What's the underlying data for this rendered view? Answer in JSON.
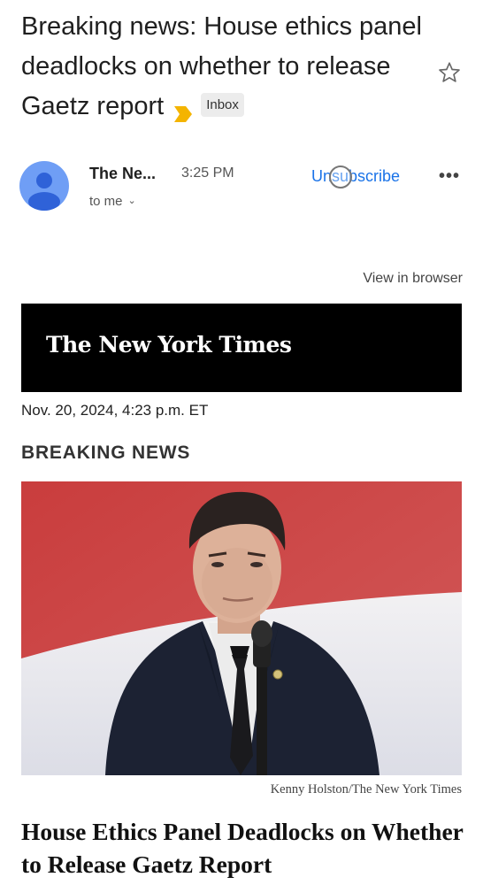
{
  "email": {
    "subject": "Breaking news: House ethics panel deadlocks on whether to release Gaetz report",
    "label": "Inbox",
    "icons": {
      "importance": "importance-marker-icon",
      "star": "star-icon",
      "avatar": "person-avatar-icon",
      "more": "more-horizontal-icon"
    },
    "colors": {
      "importance": "#f4b400",
      "avatar": "#6f9ef5",
      "link": "#1a73e8"
    }
  },
  "sender": {
    "name": "The Ne...",
    "time": "3:25 PM",
    "recipient": "to me",
    "unsubscribe": "Unsubscribe",
    "more": "•••"
  },
  "body": {
    "view_in_browser": "View in browser",
    "masthead": "The New York Times",
    "dateline": "Nov. 20, 2024, 4:23 p.m. ET",
    "section": "BREAKING NEWS",
    "photo_credit": "Kenny Holston/The New York Times",
    "headline": "House Ethics Panel Deadlocks on Whether to Release Gaetz Report"
  }
}
